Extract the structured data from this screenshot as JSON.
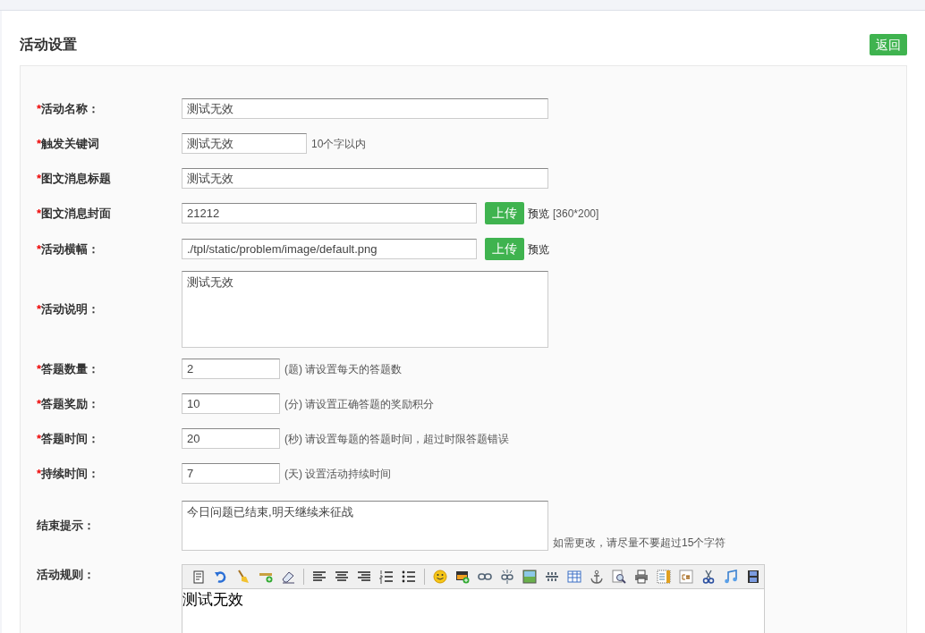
{
  "page_title": "活动设置",
  "back_button": "返回",
  "fields": [
    {
      "kind": "long",
      "marker": "*",
      "label": "活动名称：",
      "value": "测试无效"
    },
    {
      "kind": "short",
      "marker": "*",
      "label": "触发关键词",
      "value": "测试无效",
      "hint": "10个字以内"
    },
    {
      "kind": "long",
      "marker": "*",
      "label": "图文消息标题",
      "value": "测试无效"
    },
    {
      "kind": "upload",
      "marker": "*",
      "label": "图文消息封面",
      "value": "21212",
      "button": "上传",
      "preview": "预览",
      "hint": "[360*200]"
    },
    {
      "kind": "upload",
      "marker": "*",
      "label": "活动横幅：",
      "value": "./tpl/static/problem/image/default.png",
      "button": "上传",
      "preview": "预览"
    },
    {
      "kind": "textarea",
      "marker": "*",
      "label": "活动说明：",
      "value": "测试无效"
    },
    {
      "kind": "number",
      "marker": "*",
      "label": "答题数量：",
      "value": "2",
      "hint": "(题) 请设置每天的答题数"
    },
    {
      "kind": "number",
      "marker": "*",
      "label": "答题奖励：",
      "value": "10",
      "hint": "(分) 请设置正确答题的奖励积分"
    },
    {
      "kind": "number",
      "marker": "*",
      "label": "答题时间：",
      "value": "20",
      "hint": "(秒) 请设置每题的答题时间，超过时限答题错误"
    },
    {
      "kind": "number",
      "marker": "*",
      "label": "持续时间：",
      "value": "7",
      "hint": "(天) 设置活动持续时间"
    },
    {
      "kind": "short-textarea",
      "label": "结束提示：",
      "value": "今日问题已结束,明天继续来征战",
      "hint": "如需更改，请尽量不要超过15个字符"
    },
    {
      "kind": "editor",
      "label": "活动规则：",
      "value": "测试无效"
    }
  ]
}
